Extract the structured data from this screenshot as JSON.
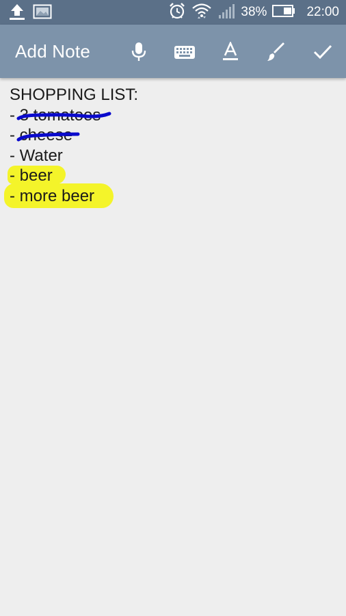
{
  "status_bar": {
    "battery_percent": "38%",
    "time": "22:00",
    "icons": [
      "upload-icon",
      "image-icon",
      "alarm-icon",
      "wifi-icon",
      "signal-icon",
      "battery-icon"
    ]
  },
  "toolbar": {
    "title": "Add Note",
    "actions": [
      "microphone-icon",
      "keyboard-icon",
      "text-format-icon",
      "brush-icon",
      "check-icon"
    ]
  },
  "note": {
    "lines": [
      {
        "text": "SHOPPING LIST:"
      },
      {
        "text": "- 3 tomatoes"
      },
      {
        "text": "- cheese"
      },
      {
        "text": "- Water"
      },
      {
        "text": "- beer"
      },
      {
        "text": "- more beer"
      }
    ]
  },
  "colors": {
    "status_bar": "#5b7088",
    "toolbar": "#7d93aa",
    "background": "#eeeeee",
    "highlight": "#f4f42a",
    "strike_ink": "#0a0acc"
  }
}
